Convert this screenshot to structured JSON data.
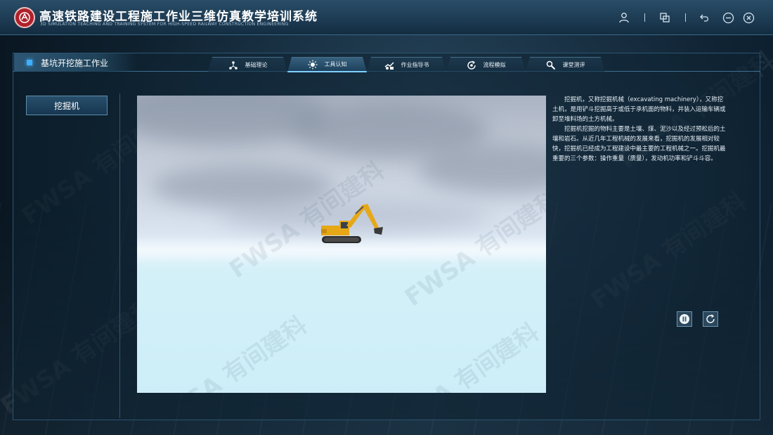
{
  "app": {
    "title": "高速铁路建设工程施工作业三维仿真教学培训系统",
    "subtitle": "3D SIMULATION TEACHING AND TRAINING SYSTEM FOR HIGH-SPEED RAILWAY CONSTRUCTION ENGINEERING"
  },
  "window_controls": {
    "icons": [
      "user-icon",
      "window-switch-icon",
      "back-icon",
      "minimize-icon",
      "close-icon"
    ]
  },
  "section": {
    "title": "基坑开挖施工作业"
  },
  "tabs": [
    {
      "label": "基础理论",
      "icon": "network-icon",
      "active": false
    },
    {
      "label": "工具认知",
      "icon": "gear-sun-icon",
      "active": true
    },
    {
      "label": "作业指导书",
      "icon": "guide-icon",
      "active": false
    },
    {
      "label": "流程模拟",
      "icon": "cycle-icon",
      "active": false
    },
    {
      "label": "课堂测评",
      "icon": "test-icon",
      "active": false
    }
  ],
  "equipment_list": [
    {
      "label": "挖掘机",
      "selected": true
    }
  ],
  "description": {
    "paragraphs": [
      "挖掘机，又称挖掘机械（excavating machinery），又称挖土机，是用铲斗挖掘高于或低于承机面的物料，并装入运输车辆或卸至堆料场的土方机械。",
      "挖掘机挖掘的物料主要是土壤、煤、泥沙以及经过预松后的土壤和岩石。从近几年工程机械的发展来看，挖掘机的发展相对较快，挖掘机已经成为工程建设中最主要的工程机械之一。挖掘机最重要的三个参数：操作重量（质量），发动机功率和铲斗斗容。"
    ]
  },
  "player_controls": {
    "icons": [
      "pause-icon",
      "refresh-icon"
    ]
  },
  "watermark": {
    "text": "FWSA 有间建科"
  },
  "colors": {
    "accent": "#3fb0ff",
    "titlebar": "#1c3a52",
    "logo_red": "#b0212a",
    "excavator_yellow": "#e6a817"
  }
}
